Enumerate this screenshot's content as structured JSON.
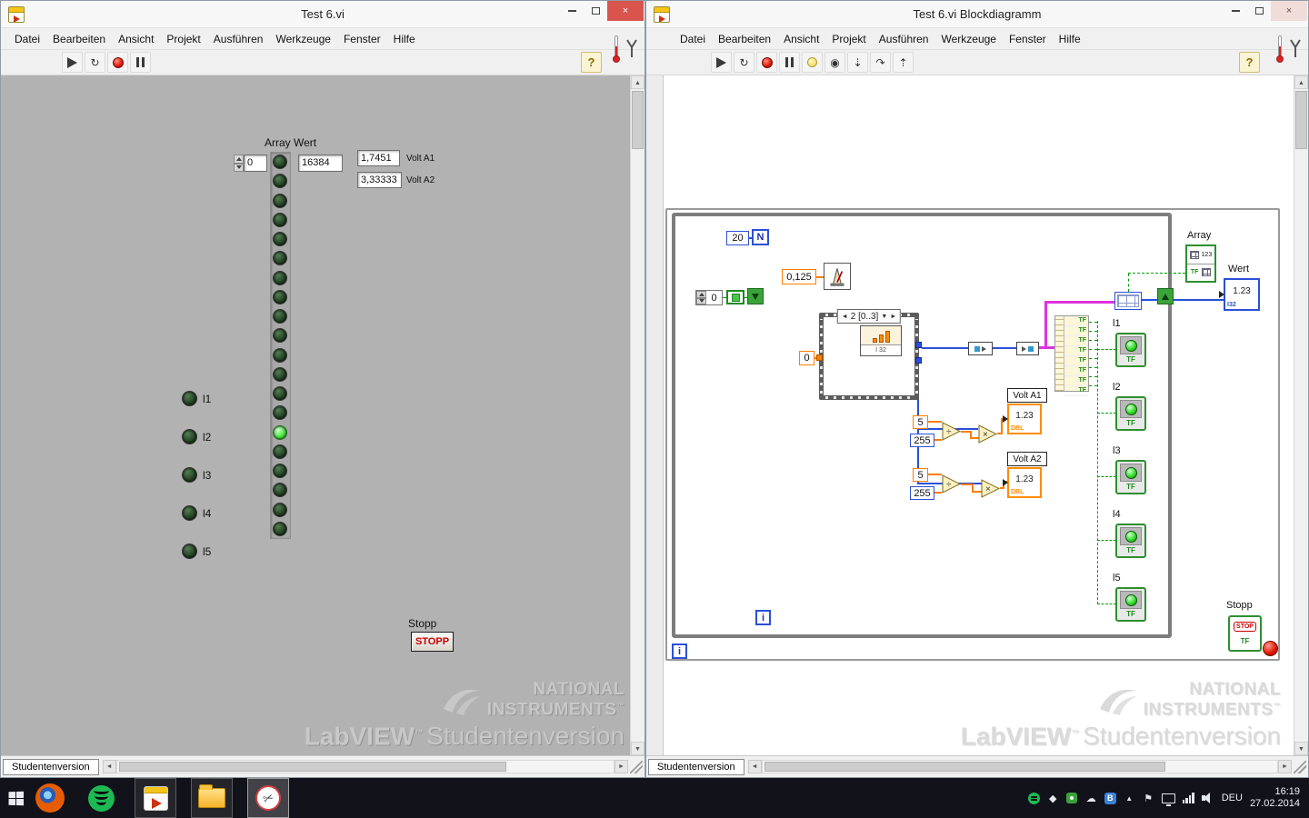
{
  "front_panel": {
    "window_title": "Test 6.vi",
    "menus": [
      "Datei",
      "Bearbeiten",
      "Ansicht",
      "Projekt",
      "Ausführen",
      "Werkzeuge",
      "Fenster",
      "Hilfe"
    ],
    "help_button": "?",
    "array_label": "Array Wert",
    "index_value": "0",
    "wert_value": "16384",
    "volt_a1_value": "1,7451",
    "volt_a1_label": "Volt A1",
    "volt_a2_value": "3,33333",
    "volt_a2_label": "Volt A2",
    "led_array": {
      "count": 20,
      "lit_index": 14
    },
    "indicator_labels": [
      "l1",
      "l2",
      "l3",
      "l4",
      "l5"
    ],
    "stopp_label": "Stopp",
    "stopp_button": "STOPP",
    "status_tab": "Studentenversion"
  },
  "block_diagram": {
    "window_title": "Test 6.vi Blockdiagramm",
    "menus": [
      "Datei",
      "Bearbeiten",
      "Ansicht",
      "Projekt",
      "Ausführen",
      "Werkzeuge",
      "Fenster",
      "Hilfe"
    ],
    "help_button": "?",
    "loop_count_terminal": "N",
    "loop_count_value": "20",
    "iteration_terminal": "i",
    "wait_constant": "0,125",
    "shift_init_value": "0",
    "case_selector": "2 [0..3]",
    "case_inner_type": "I 32",
    "channel_constant": "0",
    "scale_numerator": "5",
    "scale_denominator": "255",
    "volt_a1_label": "Volt A1",
    "volt_a2_label": "Volt A2",
    "numeric_preview": "1.23",
    "dbl_type": "DBL",
    "tf": "TF",
    "boolean_rows": 8,
    "array_label": "Array",
    "array_icon_digits": "123",
    "wert_label": "Wert",
    "wert_type": "I32",
    "indicator_labels": [
      "l1",
      "l2",
      "l3",
      "l4",
      "l5"
    ],
    "stopp_label": "Stopp",
    "stop_button_text": "STOP",
    "status_tab": "Studentenversion"
  },
  "watermark": {
    "brand_line1": "NATIONAL",
    "brand_line2": "INSTRUMENTS",
    "tm": "™",
    "product": "LabVIEW",
    "edition": "Studentenversion"
  },
  "taskbar": {
    "language": "DEU",
    "time": "16:19",
    "date": "27.02.2014"
  }
}
